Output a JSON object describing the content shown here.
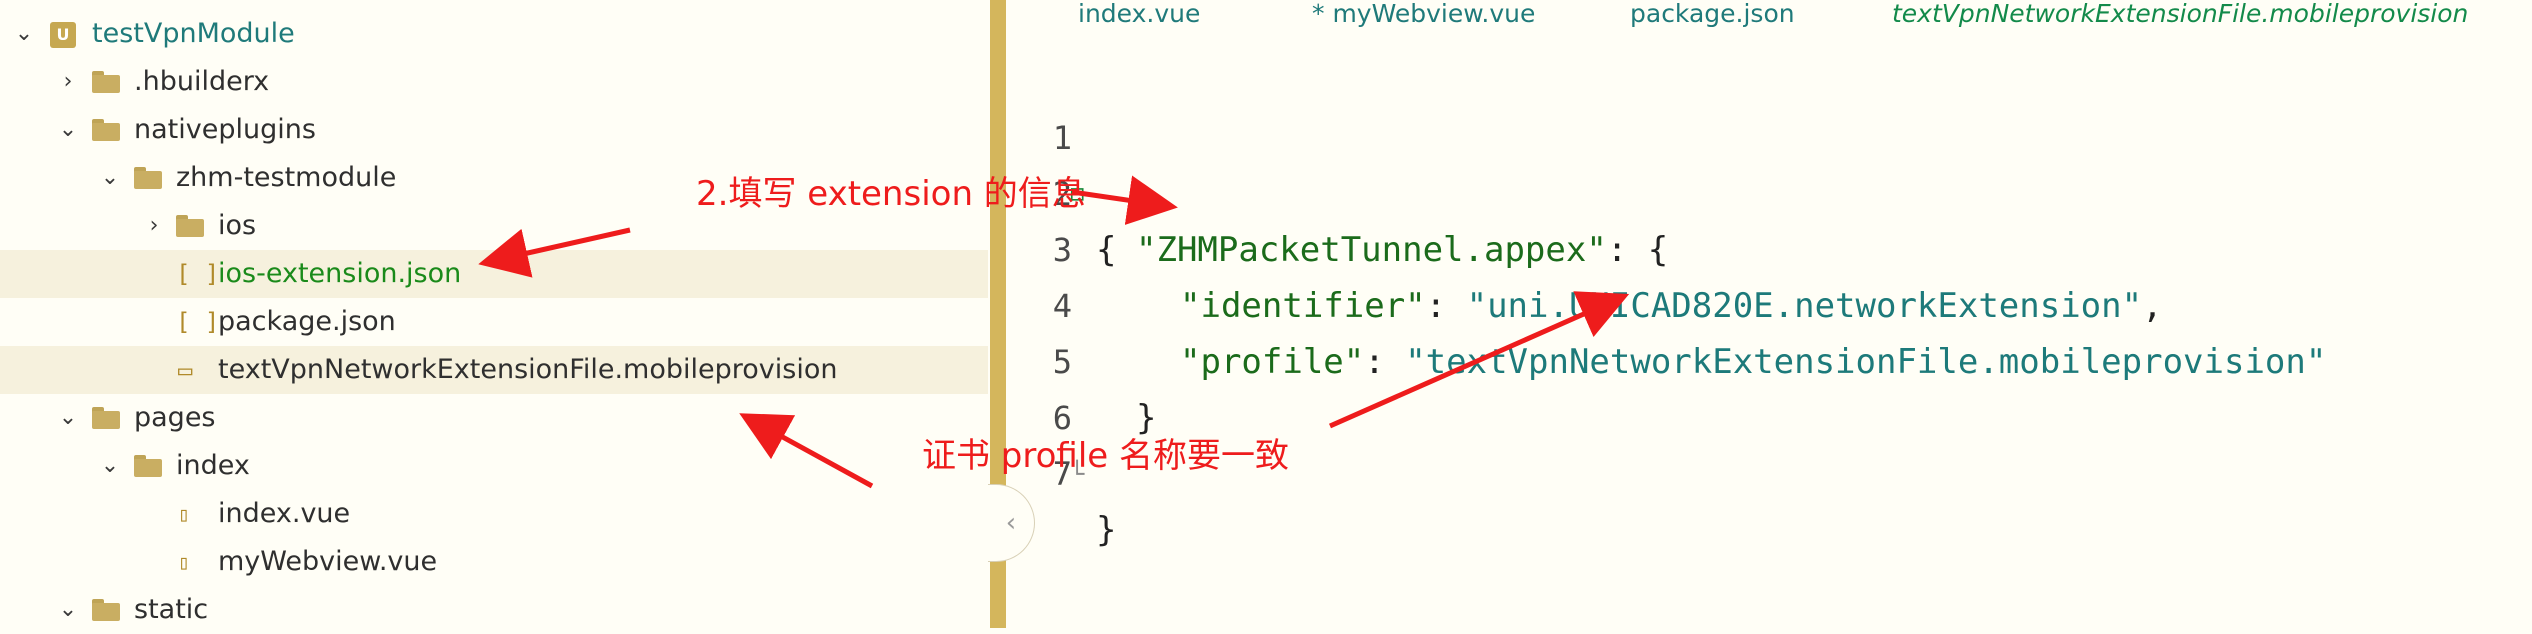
{
  "explorer": {
    "items": [
      {
        "label": "testVpnModule",
        "kind": "project"
      },
      {
        "label": ".hbuilderx",
        "kind": "folder"
      },
      {
        "label": "nativeplugins",
        "kind": "folder"
      },
      {
        "label": "zhm-testmodule",
        "kind": "folder"
      },
      {
        "label": "ios",
        "kind": "folder"
      },
      {
        "label": "ios-extension.json",
        "kind": "json"
      },
      {
        "label": "package.json",
        "kind": "json"
      },
      {
        "label": "textVpnNetworkExtensionFile.mobileprovision",
        "kind": "file"
      },
      {
        "label": "pages",
        "kind": "folder"
      },
      {
        "label": "index",
        "kind": "folder"
      },
      {
        "label": "index.vue",
        "kind": "vue"
      },
      {
        "label": "myWebview.vue",
        "kind": "vue"
      },
      {
        "label": "static",
        "kind": "folder"
      }
    ],
    "selected": "ios-extension.json"
  },
  "tabs": [
    {
      "label": "index.vue"
    },
    {
      "label": "* myWebview.vue"
    },
    {
      "label": "package.json"
    },
    {
      "label": "textVpnNetworkExtensionFile.mobileprovision"
    }
  ],
  "editor": {
    "line_numbers": [
      "1",
      "2",
      "3",
      "4",
      "5",
      "6",
      "7"
    ],
    "lines": {
      "l1": "{",
      "l2_key": "\"ZHMPacketTunnel.appex\"",
      "l2_rest": ": {",
      "l3_key": "\"identifier\"",
      "l3_colon": ": ",
      "l3_val": "\"uni.UNICAD820E.networkExtension\"",
      "l3_comma": ",",
      "l4_key": "\"profile\"",
      "l4_colon": ": ",
      "l4_val": "\"textVpnNetworkExtensionFile.mobileprovision\"",
      "l5": "}",
      "l6": "}"
    }
  },
  "annotations": {
    "fill_extension": "2.填写 extension 的信息",
    "profile_match": "证书 profile 名称要一致"
  },
  "colors": {
    "annotation": "#ee1c1c",
    "folder": "#c9ae62",
    "splitter": "#d4b65c",
    "selected_text": "#1a8a1a"
  }
}
